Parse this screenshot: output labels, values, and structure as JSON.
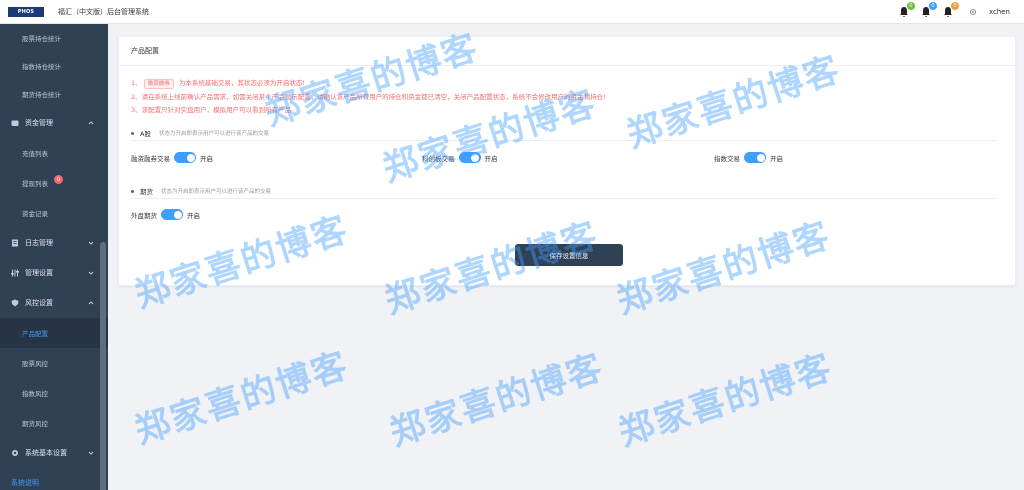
{
  "header": {
    "logo_text": "PHOS",
    "title": "福汇（中文版）后台管理系统",
    "notifications": [
      {
        "count": "0",
        "color": "#67c23a"
      },
      {
        "count": "0",
        "color": "#409eff"
      },
      {
        "count": "0",
        "color": "#e6a23c"
      }
    ],
    "username": "xchen"
  },
  "sidebar": {
    "items": [
      {
        "type": "sub",
        "label": "股票持仓统计"
      },
      {
        "type": "sub",
        "label": "指数持仓统计"
      },
      {
        "type": "sub",
        "label": "期货持仓统计"
      },
      {
        "type": "group",
        "label": "资金管理",
        "icon": "wallet-icon",
        "expanded": true
      },
      {
        "type": "sub",
        "label": "充值列表"
      },
      {
        "type": "sub",
        "label": "提现列表",
        "badge": "0"
      },
      {
        "type": "sub",
        "label": "资金记录"
      },
      {
        "type": "group",
        "label": "日志管理",
        "icon": "log-icon",
        "expanded": false
      },
      {
        "type": "group",
        "label": "管理设置",
        "icon": "settings-sliders-icon",
        "expanded": false
      },
      {
        "type": "group",
        "label": "风控设置",
        "icon": "shield-icon",
        "expanded": true
      },
      {
        "type": "sub",
        "label": "产品配置",
        "active": true
      },
      {
        "type": "sub",
        "label": "股票风控"
      },
      {
        "type": "sub",
        "label": "指数风控"
      },
      {
        "type": "sub",
        "label": "期货风控"
      },
      {
        "type": "group",
        "label": "系统基本设置",
        "icon": "gear-icon",
        "expanded": false
      },
      {
        "type": "note",
        "label": "系统说明"
      }
    ]
  },
  "card": {
    "title": "产品配置",
    "notes": {
      "line1_num": "1、",
      "line1_tag": "融资融券",
      "line1_text": "为本系统基础交易，其状态必须为开启状态!",
      "line2": "2、请在系统上线前确认产品需求，如需关闭某个产品显示配置，请确认该产品所有用户的持仓和资金都已清空，关闭产品配置状态，系统不会修改用户的资金和持仓!",
      "line3": "3、该配置只针对实盘用户，模拟用户可以看到所有产品。"
    },
    "section_a": {
      "title": "A股",
      "hint": "状态为开启即表示用户可以进行该产品的交易",
      "switches": [
        {
          "label": "融资融券交易",
          "state": "开启",
          "on": true
        },
        {
          "label": "科创板交易",
          "state": "开启",
          "on": true
        },
        {
          "label": "指数交易",
          "state": "开启",
          "on": true
        }
      ]
    },
    "section_f": {
      "title": "期货",
      "hint": "状态为开启即表示用户可以进行该产品的交易",
      "switches": [
        {
          "label": "外盘期货",
          "state": "开启",
          "on": true
        }
      ]
    },
    "save_label": "保存设置信息"
  },
  "watermark": {
    "text": "郑家喜的博客",
    "color": "#409eff"
  },
  "colors": {
    "sidebar_bg": "#304156",
    "accent": "#409eff",
    "danger": "#f56c6c"
  }
}
